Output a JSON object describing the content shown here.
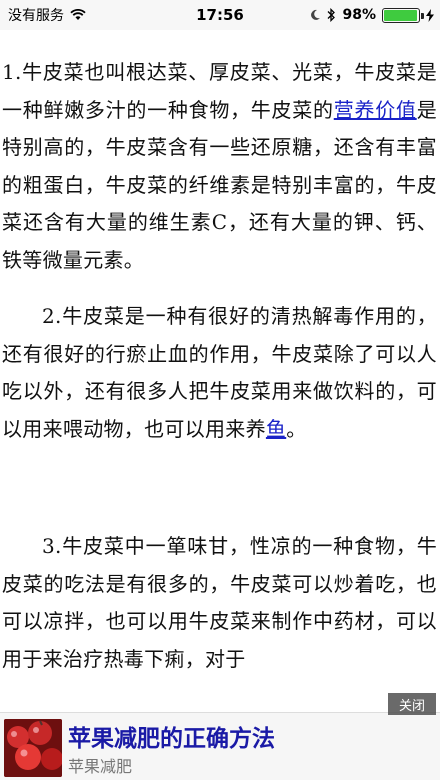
{
  "status_bar": {
    "carrier": "没有服务",
    "time": "17:56",
    "battery": "98%",
    "battery_level": 0.98,
    "icons": [
      "wifi-icon",
      "moon-icon",
      "bluetooth-icon",
      "battery-icon",
      "charging-icon"
    ]
  },
  "article": {
    "p1_a": "1.牛皮菜也叫根达菜、厚皮菜、光菜，牛皮菜是一种鲜嫩多汁的一种食物，牛皮菜的",
    "p1_link": "营养价值",
    "p1_b": "是特别高的，牛皮菜含有一些还原糖，还含有丰富的粗蛋白，牛皮菜的纤维素是特别丰富的，牛皮菜还含有大量的维生素C，还有大量的钾、钙、铁等微量元素。",
    "p2_a": "2.牛皮菜是一种有很好的清热解毒作用的，还有很好的行瘀止血的作用，牛皮菜除了可以人吃以外，还有很多人把牛皮菜用来做饮料的，可以用来喂动物，也可以用来养",
    "p2_link": "鱼",
    "p2_b": "。",
    "p3": "3.牛皮菜中一箪味甘，性凉的一种食物，牛皮菜的吃法是有很多的，牛皮菜可以炒着吃，也可以凉拌，也可以用牛皮菜来制作中",
    "p3_hidden": "药材，可以用于来治疗热毒下痢，对于"
  },
  "ad": {
    "title": "苹果减肥的正确方法",
    "subtitle": "苹果减肥",
    "close_label": "关闭",
    "title_color": "#1a1aa6"
  }
}
